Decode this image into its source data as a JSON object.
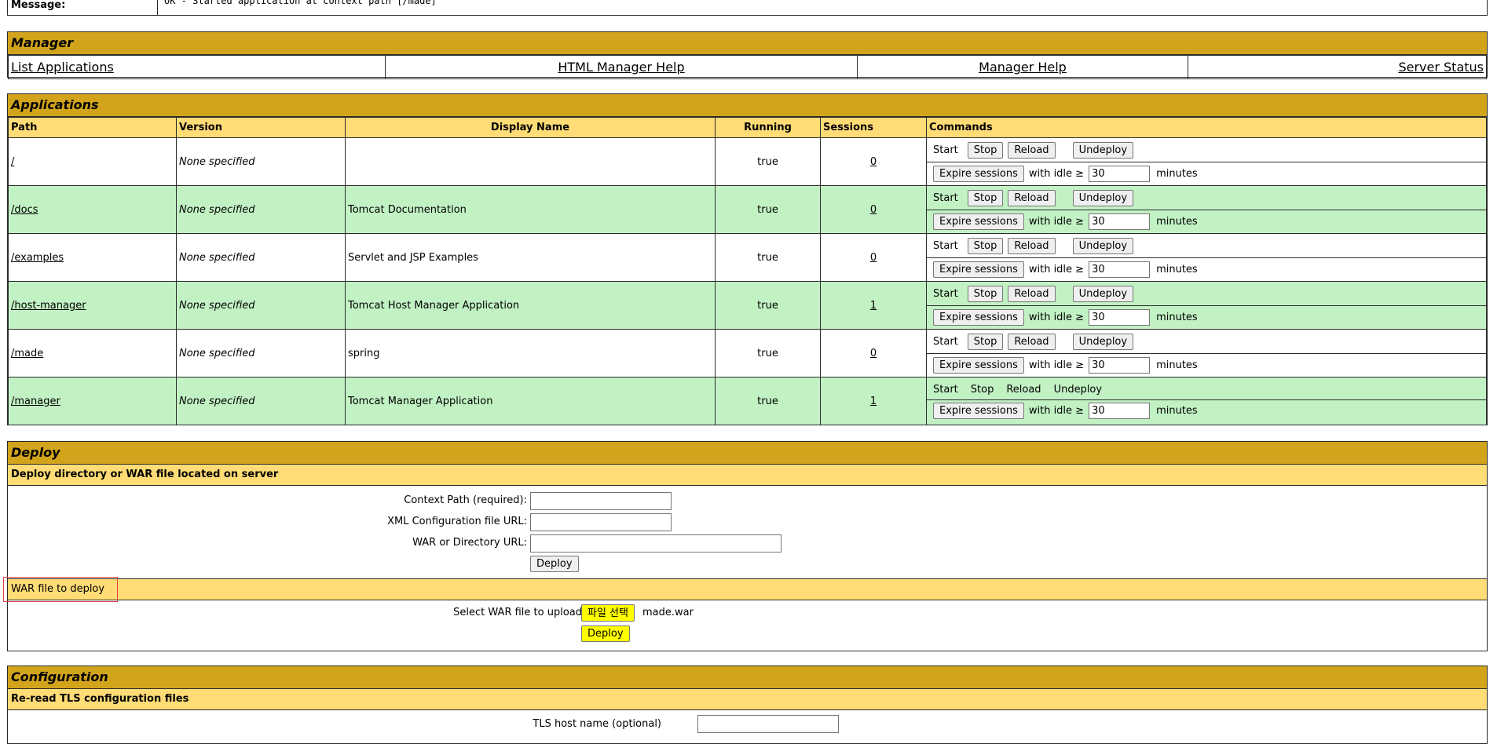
{
  "message": {
    "label": "Message:",
    "text": "OK - Started application at context path [/made]"
  },
  "manager": {
    "title": "Manager",
    "links": [
      "List Applications",
      "HTML Manager Help",
      "Manager Help",
      "Server Status"
    ]
  },
  "applications": {
    "title": "Applications",
    "headers": [
      "Path",
      "Version",
      "Display Name",
      "Running",
      "Sessions",
      "Commands"
    ],
    "rows": [
      {
        "path": "/",
        "version": "None specified",
        "display_name": "",
        "running": "true",
        "sessions": "0",
        "idle": "30"
      },
      {
        "path": "/docs",
        "version": "None specified",
        "display_name": "Tomcat Documentation",
        "running": "true",
        "sessions": "0",
        "idle": "30"
      },
      {
        "path": "/examples",
        "version": "None specified",
        "display_name": "Servlet and JSP Examples",
        "running": "true",
        "sessions": "0",
        "idle": "30"
      },
      {
        "path": "/host-manager",
        "version": "None specified",
        "display_name": "Tomcat Host Manager Application",
        "running": "true",
        "sessions": "1",
        "idle": "30"
      },
      {
        "path": "/made",
        "version": "None specified",
        "display_name": "spring",
        "running": "true",
        "sessions": "0",
        "idle": "30"
      },
      {
        "path": "/manager",
        "version": "None specified",
        "display_name": "Tomcat Manager Application",
        "running": "true",
        "sessions": "1",
        "idle": "30"
      }
    ],
    "commands": {
      "start": "Start",
      "stop": "Stop",
      "reload": "Reload",
      "undeploy": "Undeploy",
      "expire": "Expire sessions",
      "with_idle": "with idle ≥",
      "minutes": "minutes"
    }
  },
  "deploy": {
    "title": "Deploy",
    "server_section": "Deploy directory or WAR file located on server",
    "context_path_label": "Context Path (required):",
    "xml_config_label": "XML Configuration file URL:",
    "war_dir_label": "WAR or Directory URL:",
    "deploy_button": "Deploy",
    "war_section": "WAR file to deploy",
    "select_war_label": "Select WAR file to upload",
    "choose_file_button": "파일 선택",
    "chosen_file": "made.war",
    "upload_deploy_button": "Deploy"
  },
  "configuration": {
    "title": "Configuration",
    "tls_section": "Re-read TLS configuration files",
    "tls_host_label": "TLS host name (optional)"
  },
  "colors": {
    "title_bar": "#d2a41c",
    "sub_bar": "#ffdc75",
    "row_green": "#c2f2c4",
    "highlight": "#ffff00",
    "focus_outline": "#e04040"
  }
}
